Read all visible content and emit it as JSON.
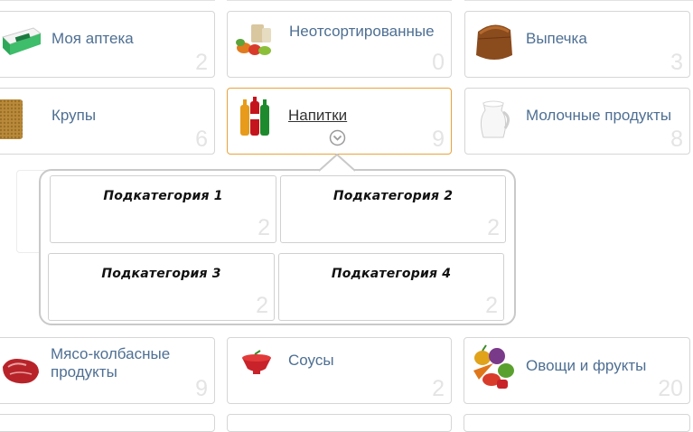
{
  "categories": [
    {
      "label": "Моя аптека",
      "count": "2"
    },
    {
      "label": "Неотсортированные",
      "count": "0"
    },
    {
      "label": "Выпечка",
      "count": "3"
    },
    {
      "label": "Крупы",
      "count": "6"
    },
    {
      "label": "Напитки",
      "count": "9"
    },
    {
      "label": "Молочные продукты",
      "count": "8"
    },
    {
      "label_line1": "Мясо-колбасные",
      "label_line2": "продукты",
      "count": "9"
    },
    {
      "label": "Соусы",
      "count": "2"
    },
    {
      "label": "Овощи и фрукты",
      "count": "20"
    }
  ],
  "subcategories": [
    {
      "label": "Подкатегория 1",
      "count": "2"
    },
    {
      "label": "Подкатегория 2",
      "count": "2"
    },
    {
      "label": "Подкатегория 3",
      "count": "2"
    },
    {
      "label": "Подкатегория 4",
      "count": "2"
    }
  ],
  "colors": {
    "label": "#4e6f93",
    "active_border": "#e8a33c",
    "count": "#e4e4e4",
    "border": "#d6d6d6"
  }
}
